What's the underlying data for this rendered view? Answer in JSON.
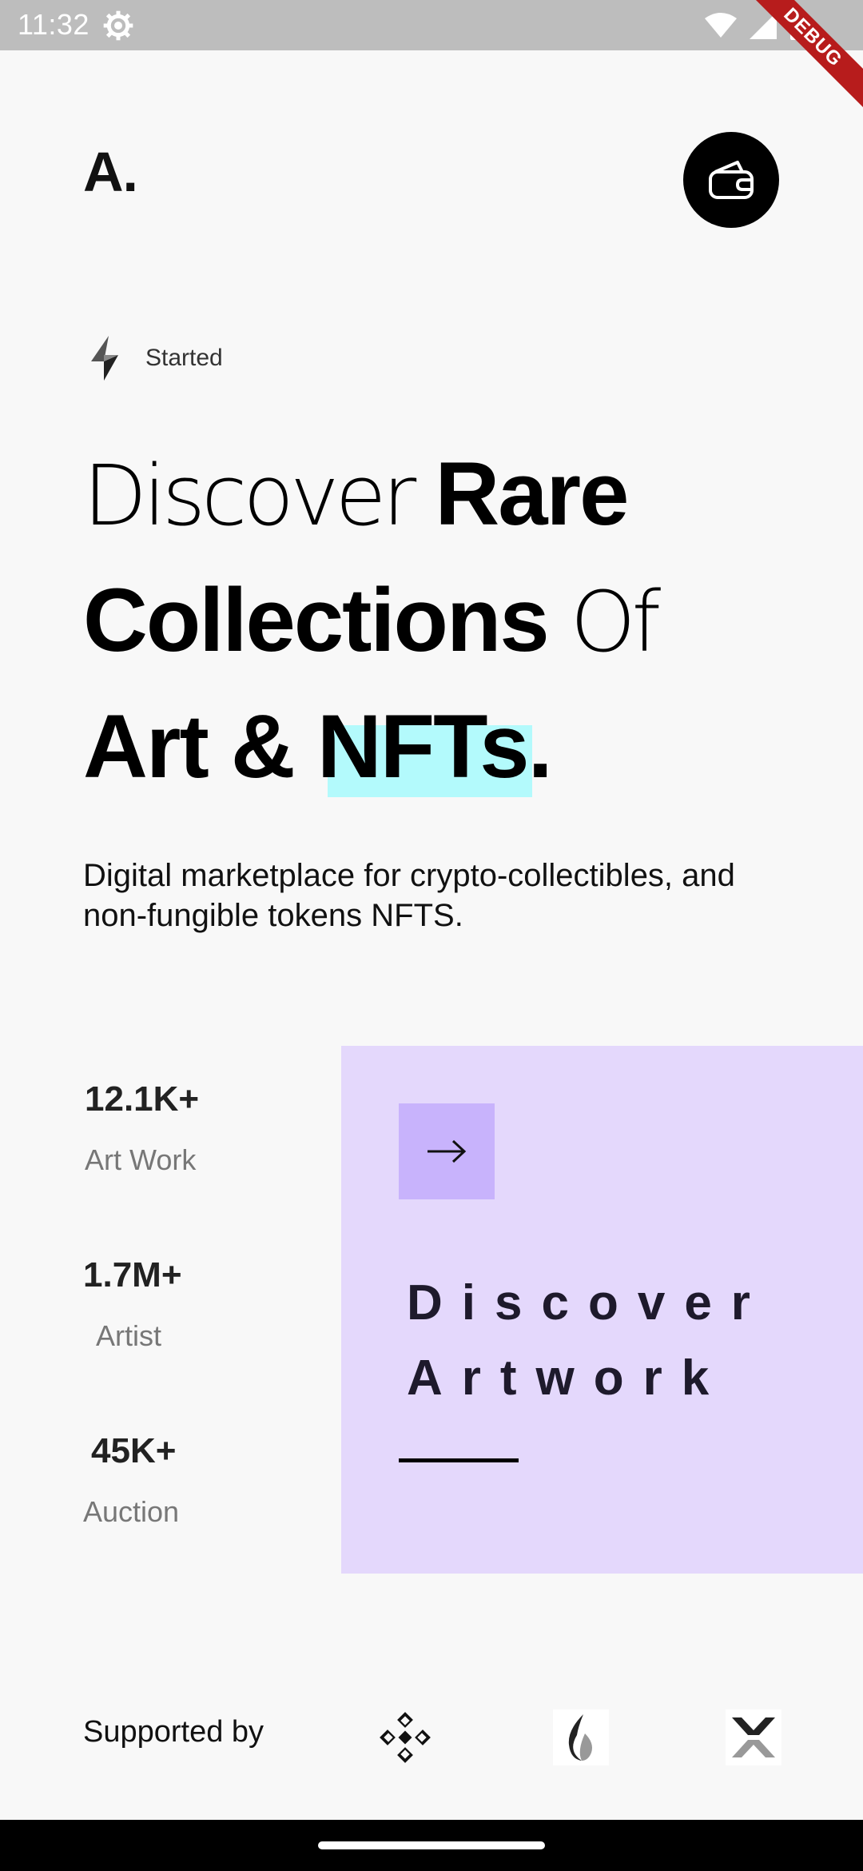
{
  "status_bar": {
    "time": "11:32",
    "debug_label": "DEBUG"
  },
  "header": {
    "logo": "A."
  },
  "started": {
    "label": "Started"
  },
  "headline": {
    "word1": "Discover ",
    "word2": "Rare",
    "word3": "Collections",
    "word4": " Of",
    "word5": "Art & NFTs."
  },
  "subtitle": "Digital marketplace for crypto-collectibles, and non-fungible tokens NFTS.",
  "stats": [
    {
      "value": "12.1K+",
      "label": "Art Work"
    },
    {
      "value": "1.7M+",
      "label": "Artist"
    },
    {
      "value": "45K+",
      "label": "Auction"
    }
  ],
  "discover_card": {
    "line1": "Discover",
    "line2": "Artwork"
  },
  "footer": {
    "supported_label": "Supported by",
    "sponsors": [
      "binance-icon",
      "flame-icon",
      "x-chevron-icon"
    ]
  },
  "colors": {
    "highlight": "#b3fafc",
    "card_bg": "#e4d8fc",
    "arrow_bg": "#c8b3fc"
  }
}
